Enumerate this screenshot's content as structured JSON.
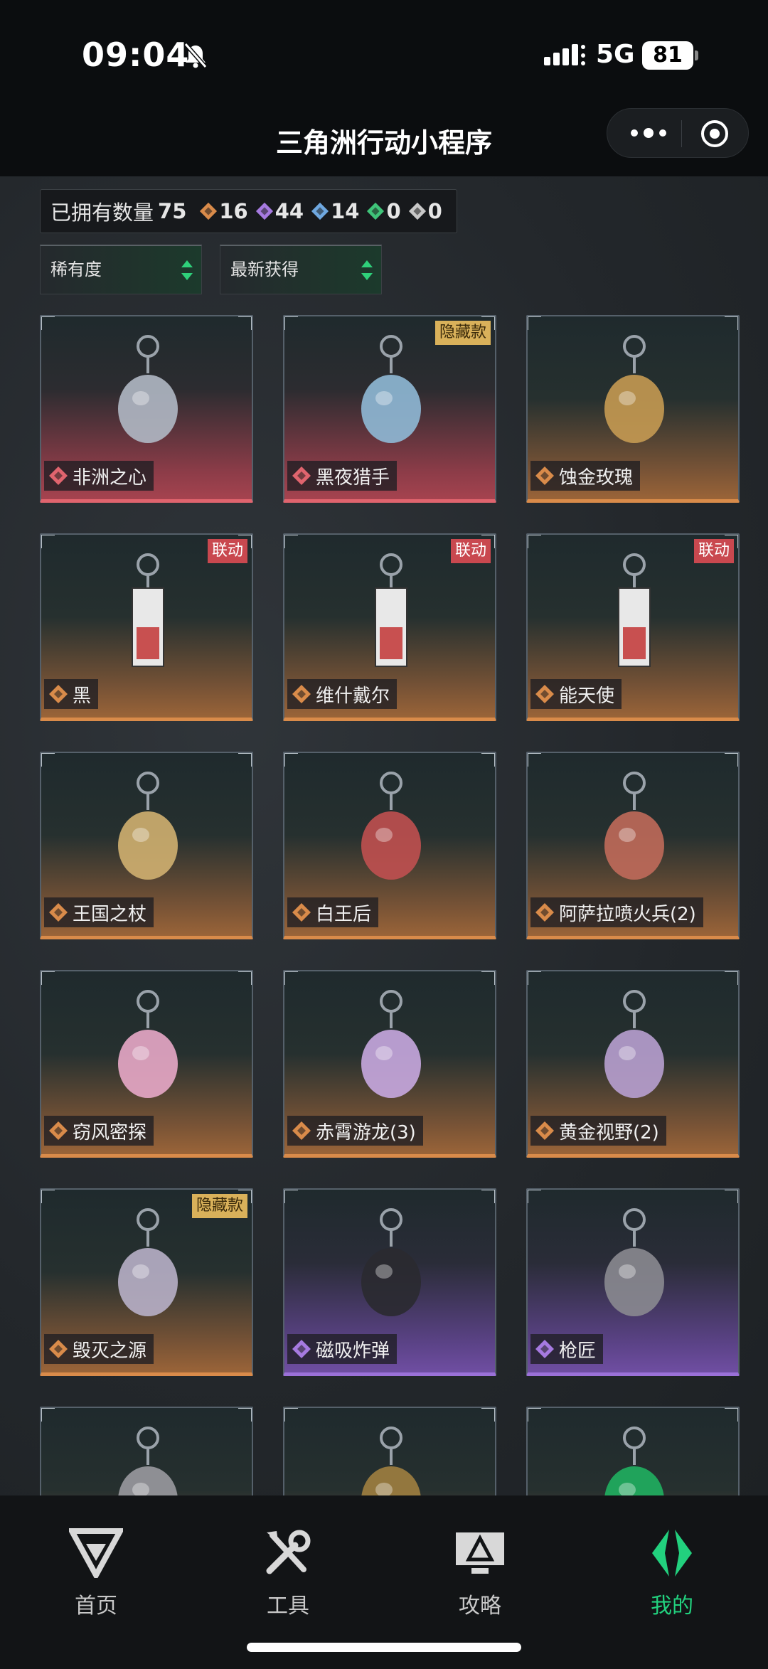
{
  "status_bar": {
    "time": "09:04",
    "network": "5G",
    "battery": "81"
  },
  "nav": {
    "title": "三角洲行动小程序"
  },
  "summary": {
    "owned_label": "已拥有数量",
    "owned_count": "75",
    "rarities": [
      {
        "color": "#d98b4a",
        "count": "16"
      },
      {
        "color": "#a67ae0",
        "count": "44"
      },
      {
        "color": "#6fa8e0",
        "count": "14"
      },
      {
        "color": "#3fc479",
        "count": "0"
      },
      {
        "color": "#c8c8c8",
        "count": "0"
      }
    ]
  },
  "filters": {
    "sort_rarity": "稀有度",
    "sort_recent": "最新获得"
  },
  "badges": {
    "hidden": "隐藏款",
    "collab": "联动"
  },
  "items": [
    {
      "name": "非洲之心",
      "rarity": "red",
      "badge": "",
      "icon": "heart-crystal-keychain-icon"
    },
    {
      "name": "黑夜猎手",
      "rarity": "red",
      "badge": "hidden",
      "icon": "wolf-figure-keychain-icon"
    },
    {
      "name": "蚀金玫瑰",
      "rarity": "gold",
      "badge": "",
      "icon": "golden-rose-keychain-icon"
    },
    {
      "name": "黑",
      "rarity": "gold",
      "badge": "collab",
      "icon": "card-keychain-icon"
    },
    {
      "name": "维什戴尔",
      "rarity": "gold",
      "badge": "collab",
      "icon": "card-keychain-icon"
    },
    {
      "name": "能天使",
      "rarity": "gold",
      "badge": "collab",
      "icon": "card-keychain-icon"
    },
    {
      "name": "王国之杖",
      "rarity": "gold",
      "badge": "",
      "icon": "king-figure-keychain-icon"
    },
    {
      "name": "白王后",
      "rarity": "gold",
      "badge": "",
      "icon": "queen-figure-keychain-icon"
    },
    {
      "name": "阿萨拉喷火兵(2)",
      "rarity": "gold",
      "badge": "",
      "icon": "flamethrower-figure-keychain-icon"
    },
    {
      "name": "窃风密探",
      "rarity": "gold",
      "badge": "",
      "icon": "rabbit-spy-keychain-icon"
    },
    {
      "name": "赤霄游龙(3)",
      "rarity": "gold",
      "badge": "",
      "icon": "dragon-figure-keychain-icon"
    },
    {
      "name": "黄金视野(2)",
      "rarity": "gold",
      "badge": "",
      "icon": "goggles-figure-keychain-icon"
    },
    {
      "name": "毁灭之源",
      "rarity": "gold",
      "badge": "hidden",
      "icon": "mecha-dragon-keychain-icon"
    },
    {
      "name": "磁吸炸弹",
      "rarity": "purple",
      "badge": "",
      "icon": "bomb-keychain-icon"
    },
    {
      "name": "枪匠",
      "rarity": "purple",
      "badge": "",
      "icon": "gun-case-keychain-icon"
    },
    {
      "name": "",
      "rarity": "gold",
      "badge": "",
      "icon": "keychain-icon"
    },
    {
      "name": "",
      "rarity": "gold",
      "badge": "",
      "icon": "keychain-icon"
    },
    {
      "name": "",
      "rarity": "gold",
      "badge": "",
      "icon": "keychain-icon"
    }
  ],
  "tabs": [
    {
      "label": "首页",
      "icon": "home-logo-icon",
      "active": false
    },
    {
      "label": "工具",
      "icon": "tools-icon",
      "active": false
    },
    {
      "label": "攻略",
      "icon": "guide-monitor-icon",
      "active": false
    },
    {
      "label": "我的",
      "icon": "profile-logo-icon",
      "active": true
    }
  ]
}
